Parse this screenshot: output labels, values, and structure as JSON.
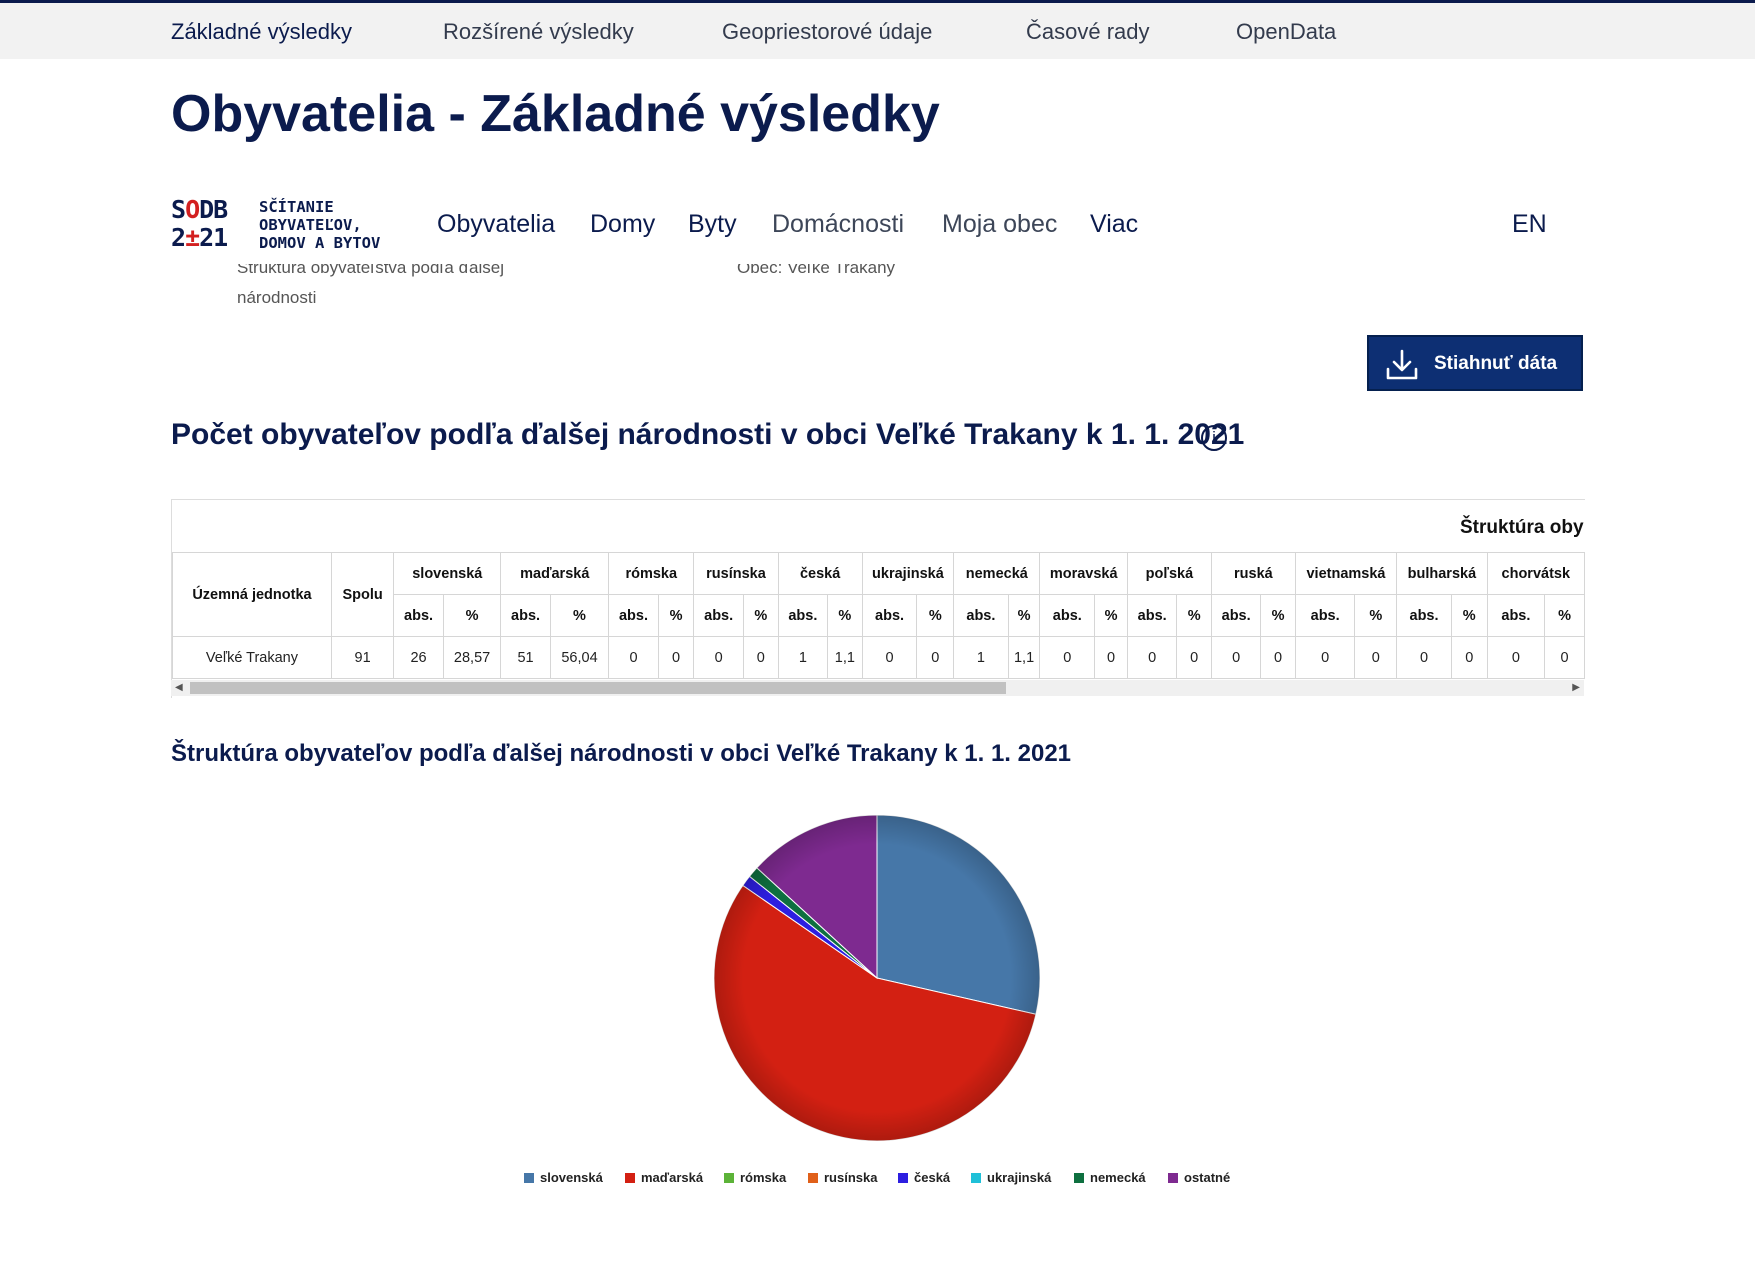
{
  "top_nav": [
    "Základné výsledky",
    "Rozšírené výsledky",
    "Geopriestorové údaje",
    "Časové rady",
    "OpenData"
  ],
  "page_title": "Obyvatelia - Základné výsledky",
  "logo": {
    "line1_a": "S",
    "line1_b": "O",
    "line1_c": "DB",
    "line2_a": "2",
    "line2_b": "±",
    "line2_c": "21",
    "text1": "SČÍTANIE",
    "text2": "OBYVATEĽOV,",
    "text3": "DOMOV A BYTOV"
  },
  "main_nav": [
    "Obyvatelia",
    "Domy",
    "Byty",
    "Domácnosti",
    "Moja obec",
    "Viac"
  ],
  "lang": "EN",
  "ghost_left": "Štruktúra obyvateľstva podľa ďalšej",
  "ghost_left_2": "národnosti",
  "ghost_right": "Obec: Veľké Trakany",
  "download_button": "Stiahnuť dáta",
  "section_title": "Počet obyvateľov podľa ďalšej národnosti v obci Veľké Trakany k 1. 1. 2021",
  "info_icon": "i",
  "table": {
    "group_header": "Štruktúra oby",
    "col_unit": "Územná jednotka",
    "col_total": "Spolu",
    "groups": [
      "slovenská",
      "maďarská",
      "rómska",
      "rusínska",
      "česká",
      "ukrajinská",
      "nemecká",
      "moravská",
      "poľská",
      "ruská",
      "vietnamská",
      "bulharská",
      "chorvátsk"
    ],
    "sub_abs": "abs.",
    "sub_pct": "%",
    "row": {
      "unit": "Veľké Trakany",
      "total": "91",
      "values": [
        [
          "26",
          "28,57"
        ],
        [
          "51",
          "56,04"
        ],
        [
          "0",
          "0"
        ],
        [
          "0",
          "0"
        ],
        [
          "1",
          "1,1"
        ],
        [
          "0",
          "0"
        ],
        [
          "1",
          "1,1"
        ],
        [
          "0",
          "0"
        ],
        [
          "0",
          "0"
        ],
        [
          "0",
          "0"
        ],
        [
          "0",
          "0"
        ],
        [
          "0",
          "0"
        ],
        [
          "0",
          "0"
        ]
      ]
    }
  },
  "chart_title": "Štruktúra obyvateľov podľa ďalšej národnosti v obci Veľké Trakany k 1. 1. 2021",
  "chart_data": {
    "type": "pie",
    "categories": [
      "slovenská",
      "maďarská",
      "rómska",
      "rusínska",
      "česká",
      "ukrajinská",
      "nemecká",
      "ostatné"
    ],
    "values": [
      26,
      51,
      0,
      0,
      1,
      0,
      1,
      12
    ],
    "colors": [
      "#4677a8",
      "#d32012",
      "#5cb338",
      "#e0601a",
      "#2d1ee0",
      "#20c0d8",
      "#0e7040",
      "#7e2a90"
    ],
    "legend_position": "bottom"
  }
}
